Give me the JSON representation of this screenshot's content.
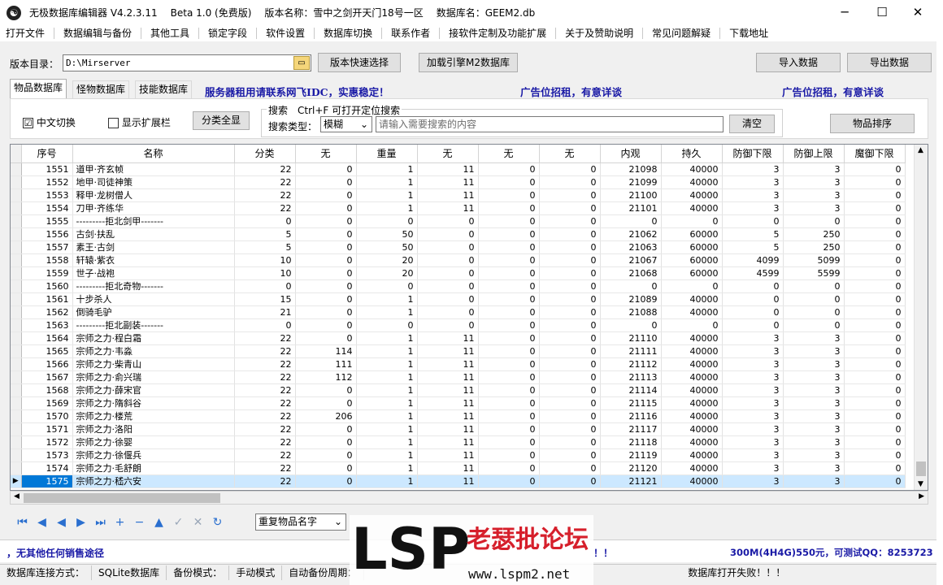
{
  "window": {
    "app_name": "无极数据库编辑器 V4.2.3.11",
    "edition": "Beta 1.0 (免费版)",
    "version_name": "版本名称：雪中之剑开天门18号一区",
    "db_name": "数据库名：GEEM2.db",
    "min": "─",
    "max": "☐",
    "close": "✕"
  },
  "menu": [
    "打开文件",
    "数据编辑与备份",
    "其他工具",
    "锁定字段",
    "软件设置",
    "数据库切换",
    "联系作者",
    "接软件定制及功能扩展",
    "关于及赞助说明",
    "常见问题解疑",
    "下载地址"
  ],
  "toolbar": {
    "dir_label": "版本目录：",
    "dir_value": "D:\\Mirserver",
    "quick_select": "版本快速选择",
    "load_engine": "加载引擎M2数据库",
    "import": "导入数据",
    "export": "导出数据"
  },
  "tabs": [
    "物品数据库",
    "怪物数据库",
    "技能数据库"
  ],
  "ads": {
    "ad1": "服务器租用请联系网飞IDC，实惠稳定！",
    "ad2": "广告位招租，有意详谈",
    "ad3": "广告位招租，有意详谈"
  },
  "filter": {
    "cn_switch": "中文切换",
    "cn_checked": "☑",
    "show_ext": "显示扩展栏",
    "show_all": "分类全显",
    "search_title": "搜索　Ctrl+F 可打开定位搜索",
    "search_type_label": "搜索类型：",
    "search_type_value": "模糊",
    "search_placeholder": "请输入需要搜索的内容",
    "clear": "清空",
    "sort": "物品排序"
  },
  "grid": {
    "columns": [
      "序号",
      "名称",
      "分类",
      "无",
      "重量",
      "无",
      "无",
      "无",
      "内观",
      "持久",
      "防御下限",
      "防御上限",
      "魔御下限"
    ],
    "rows": [
      [
        "1551",
        "道甲·齐玄帧",
        "22",
        "0",
        "1",
        "11",
        "0",
        "0",
        "21098",
        "40000",
        "3",
        "3",
        "0"
      ],
      [
        "1552",
        "地甲·司徒神策",
        "22",
        "0",
        "1",
        "11",
        "0",
        "0",
        "21099",
        "40000",
        "3",
        "3",
        "0"
      ],
      [
        "1553",
        "释甲·龙树僧人",
        "22",
        "0",
        "1",
        "11",
        "0",
        "0",
        "21100",
        "40000",
        "3",
        "3",
        "0"
      ],
      [
        "1554",
        "刀甲·齐练华",
        "22",
        "0",
        "1",
        "11",
        "0",
        "0",
        "21101",
        "40000",
        "3",
        "3",
        "0"
      ],
      [
        "1555",
        "---------拒北剑甲-------",
        "0",
        "0",
        "0",
        "0",
        "0",
        "0",
        "0",
        "0",
        "0",
        "0",
        "0"
      ],
      [
        "1556",
        "古剑·扶乱",
        "5",
        "0",
        "50",
        "0",
        "0",
        "0",
        "21062",
        "60000",
        "5",
        "250",
        "0"
      ],
      [
        "1557",
        "素王·古剑",
        "5",
        "0",
        "50",
        "0",
        "0",
        "0",
        "21063",
        "60000",
        "5",
        "250",
        "0"
      ],
      [
        "1558",
        "轩辕·紫衣",
        "10",
        "0",
        "20",
        "0",
        "0",
        "0",
        "21067",
        "60000",
        "4099",
        "5099",
        "0"
      ],
      [
        "1559",
        "世子·战袍",
        "10",
        "0",
        "20",
        "0",
        "0",
        "0",
        "21068",
        "60000",
        "4599",
        "5599",
        "0"
      ],
      [
        "1560",
        "---------拒北奇物-------",
        "0",
        "0",
        "0",
        "0",
        "0",
        "0",
        "0",
        "0",
        "0",
        "0",
        "0"
      ],
      [
        "1561",
        "十步杀人",
        "15",
        "0",
        "1",
        "0",
        "0",
        "0",
        "21089",
        "40000",
        "0",
        "0",
        "0"
      ],
      [
        "1562",
        "倒骑毛驴",
        "21",
        "0",
        "1",
        "0",
        "0",
        "0",
        "21088",
        "40000",
        "0",
        "0",
        "0"
      ],
      [
        "1563",
        "---------拒北副装-------",
        "0",
        "0",
        "0",
        "0",
        "0",
        "0",
        "0",
        "0",
        "0",
        "0",
        "0"
      ],
      [
        "1564",
        "宗师之力·程白霜",
        "22",
        "0",
        "1",
        "11",
        "0",
        "0",
        "21110",
        "40000",
        "3",
        "3",
        "0"
      ],
      [
        "1565",
        "宗师之力·韦淼",
        "22",
        "114",
        "1",
        "11",
        "0",
        "0",
        "21111",
        "40000",
        "3",
        "3",
        "0"
      ],
      [
        "1566",
        "宗师之力·柴青山",
        "22",
        "111",
        "1",
        "11",
        "0",
        "0",
        "21112",
        "40000",
        "3",
        "3",
        "0"
      ],
      [
        "1567",
        "宗师之力·俞兴瑞",
        "22",
        "112",
        "1",
        "11",
        "0",
        "0",
        "21113",
        "40000",
        "3",
        "3",
        "0"
      ],
      [
        "1568",
        "宗师之力·薛宋官",
        "22",
        "0",
        "1",
        "11",
        "0",
        "0",
        "21114",
        "40000",
        "3",
        "3",
        "0"
      ],
      [
        "1569",
        "宗师之力·隋斜谷",
        "22",
        "0",
        "1",
        "11",
        "0",
        "0",
        "21115",
        "40000",
        "3",
        "3",
        "0"
      ],
      [
        "1570",
        "宗师之力·楼荒",
        "22",
        "206",
        "1",
        "11",
        "0",
        "0",
        "21116",
        "40000",
        "3",
        "3",
        "0"
      ],
      [
        "1571",
        "宗师之力·洛阳",
        "22",
        "0",
        "1",
        "11",
        "0",
        "0",
        "21117",
        "40000",
        "3",
        "3",
        "0"
      ],
      [
        "1572",
        "宗师之力·徐婴",
        "22",
        "0",
        "1",
        "11",
        "0",
        "0",
        "21118",
        "40000",
        "3",
        "3",
        "0"
      ],
      [
        "1573",
        "宗师之力·徐偃兵",
        "22",
        "0",
        "1",
        "11",
        "0",
        "0",
        "21119",
        "40000",
        "3",
        "3",
        "0"
      ],
      [
        "1574",
        "宗师之力·毛舒朗",
        "22",
        "0",
        "1",
        "11",
        "0",
        "0",
        "21120",
        "40000",
        "3",
        "3",
        "0"
      ],
      [
        "1575",
        "宗师之力·嵇六安",
        "22",
        "0",
        "1",
        "11",
        "0",
        "0",
        "21121",
        "40000",
        "3",
        "3",
        "0"
      ]
    ],
    "selected_index": 24
  },
  "nav": {
    "icons": [
      "first-icon",
      "prev-page-icon",
      "prev-icon",
      "next-icon",
      "last-icon",
      "add-icon",
      "delete-icon",
      "up-icon",
      "confirm-icon",
      "cancel-icon",
      "refresh-icon"
    ],
    "glyphs": [
      "⏮",
      "◀",
      "◀",
      "▶",
      "⏭",
      "+",
      "−",
      "▲",
      "✓",
      "✕",
      "↻"
    ],
    "dup_select": "重复物品名字"
  },
  "notice": {
    "left": "，无其他任何销售途径",
    "mid": "！！",
    "right": "300M(4H4G)550元，可测试QQ：8253723"
  },
  "status": {
    "conn_label": "数据库连接方式：",
    "conn_value": "SQLite数据库",
    "backup_label": "备份模式：",
    "backup_value": "手动模式",
    "auto_label": "自动备份周期：",
    "open_fail": "数据库打开失败！！！"
  },
  "watermark": {
    "big": "LSP",
    "cn": "老瑟批论坛",
    "url": "www.lspm2.net"
  }
}
